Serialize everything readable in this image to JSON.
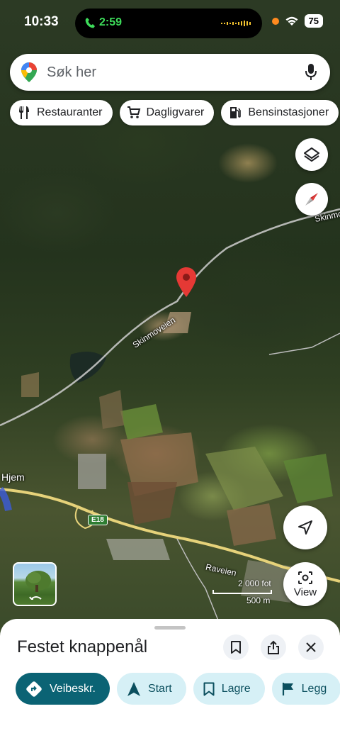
{
  "status_bar": {
    "time": "10:33",
    "call_time": "2:59",
    "battery": "75"
  },
  "search": {
    "placeholder": "Søk her"
  },
  "chips": [
    {
      "label": "Restauranter",
      "icon": "fork-knife-icon"
    },
    {
      "label": "Dagligvarer",
      "icon": "shopping-cart-icon"
    },
    {
      "label": "Bensinstasjoner",
      "icon": "fuel-pump-icon"
    }
  ],
  "map": {
    "road_labels": {
      "skinmoveien": "Skinmoveien",
      "skinmo_top": "Skinmo",
      "raveien": "Raveien",
      "hjem": "Hjem",
      "e18": "E18"
    },
    "scale": {
      "feet": "2 000 fot",
      "meters": "500 m"
    },
    "view_label": "View"
  },
  "sheet": {
    "title": "Festet knappenål",
    "actions": [
      {
        "label": "Veibeskr.",
        "icon": "directions-icon"
      },
      {
        "label": "Start",
        "icon": "navigation-arrow-icon"
      },
      {
        "label": "Lagre",
        "icon": "bookmark-icon"
      },
      {
        "label": "Legg",
        "icon": "flag-icon"
      }
    ]
  },
  "colors": {
    "accent": "#0b6374",
    "secondary_action": "#d6f0f6",
    "pin": "#e53935"
  }
}
